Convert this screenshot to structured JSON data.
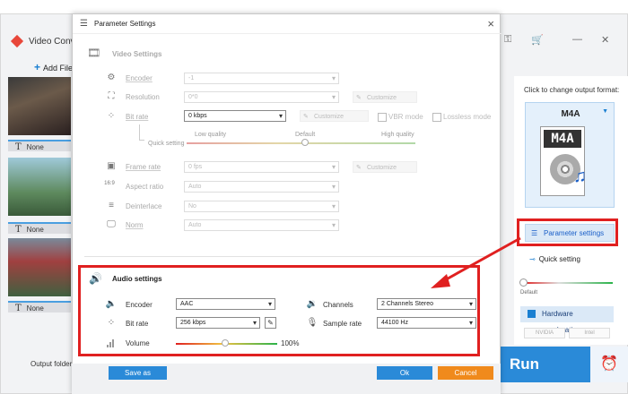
{
  "app": {
    "title": "Video Conv",
    "add_files": "Add Files",
    "output_folder_label": "Output folder:",
    "thumbnails": [
      {
        "subtitle": "None"
      },
      {
        "subtitle": "None"
      },
      {
        "subtitle": "None"
      }
    ],
    "output_panel": {
      "hint": "Click to change output format:",
      "format": "M4A",
      "doc_label": "M4A",
      "param_button": "Parameter settings",
      "quick_setting": "Quick setting",
      "default_label": "Default",
      "hw_accel": "Hardware acceleration",
      "vendors": [
        "NVIDIA",
        "Intel"
      ]
    },
    "run_label": "Run"
  },
  "dialog": {
    "title": "Parameter Settings",
    "video": {
      "section_title": "Video Settings",
      "encoder_label": "Encoder",
      "encoder_value": "-1",
      "resolution_label": "Resolution",
      "resolution_value": "0*0",
      "customize": "Customize",
      "bitrate_label": "Bit rate",
      "bitrate_value": "0 kbps",
      "vbr_mode": "VBR mode",
      "lossless_mode": "Lossless mode",
      "quick_setting": "Quick setting",
      "low_quality": "Low quality",
      "default": "Default",
      "high_quality": "High quality",
      "framerate_label": "Frame rate",
      "framerate_value": "0 fps",
      "aspect_label": "Aspect ratio",
      "aspect_value": "Auto",
      "deinterlace_label": "Deinterlace",
      "deinterlace_value": "No",
      "norm_label": "Norm",
      "norm_value": "Auto"
    },
    "audio": {
      "section_title": "Audio settings",
      "encoder_label": "Encoder",
      "encoder_value": "AAC",
      "bitrate_label": "Bit rate",
      "bitrate_value": "256 kbps",
      "volume_label": "Volume",
      "volume_value": "100%",
      "channels_label": "Channels",
      "channels_value": "2 Channels Stereo",
      "samplerate_label": "Sample rate",
      "samplerate_value": "44100 Hz"
    },
    "buttons": {
      "save_as": "Save as",
      "ok": "Ok",
      "cancel": "Cancel"
    }
  },
  "colors": {
    "accent_blue": "#2a8ad8",
    "highlight_red": "#e02020",
    "cancel_orange": "#f08a1c"
  }
}
